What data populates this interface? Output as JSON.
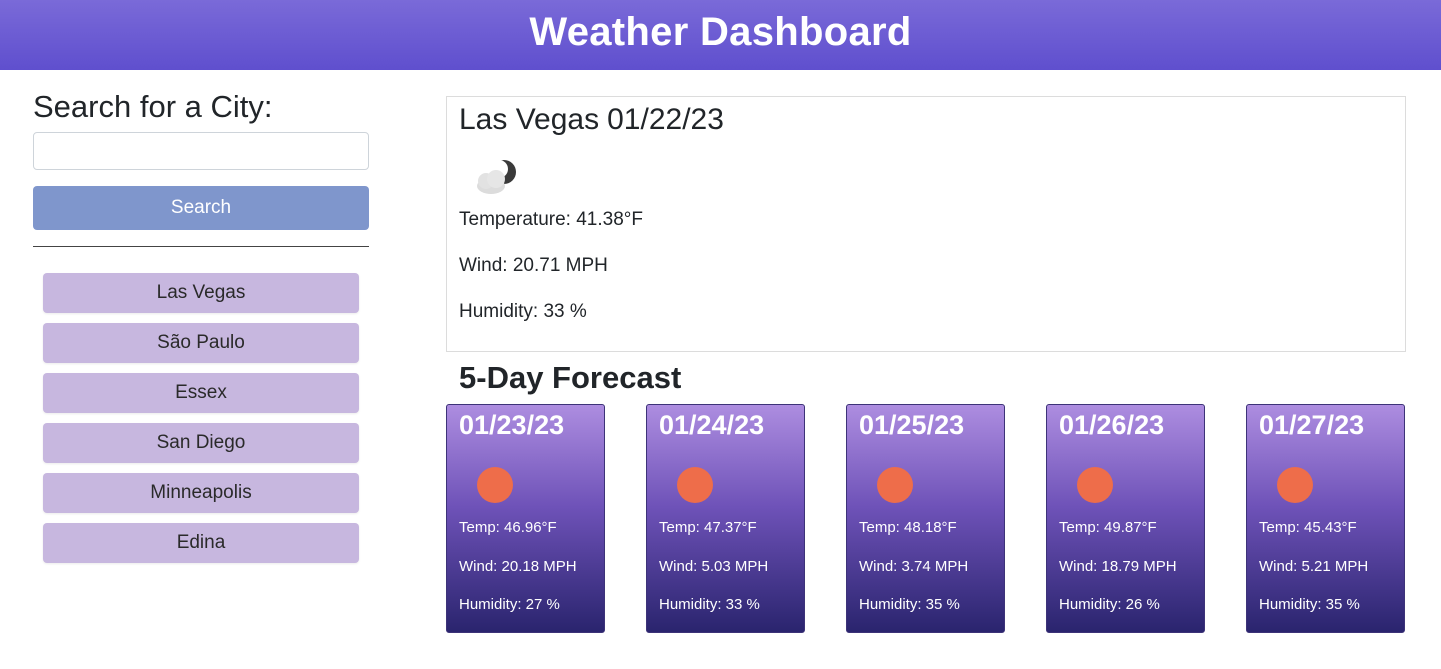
{
  "header": {
    "title": "Weather Dashboard"
  },
  "sidebar": {
    "search_title": "Search for a City:",
    "search_input_value": "",
    "search_button_label": "Search",
    "history": [
      {
        "label": "Las Vegas"
      },
      {
        "label": "São Paulo"
      },
      {
        "label": "Essex"
      },
      {
        "label": "San Diego"
      },
      {
        "label": "Minneapolis"
      },
      {
        "label": "Edina"
      }
    ]
  },
  "current": {
    "city": "Las Vegas",
    "date": "01/22/23",
    "icon": "partly-cloudy-night-icon",
    "temperature": "Temperature: 41.38°F",
    "wind": "Wind: 20.71 MPH",
    "humidity": "Humidity: 33 %"
  },
  "forecast": {
    "title": "5-Day Forecast",
    "days": [
      {
        "date": "01/23/23",
        "icon": "sun-icon",
        "temp": "Temp: 46.96°F",
        "wind": "Wind: 20.18 MPH",
        "humidity": "Humidity: 27 %"
      },
      {
        "date": "01/24/23",
        "icon": "sun-icon",
        "temp": "Temp: 47.37°F",
        "wind": "Wind: 5.03 MPH",
        "humidity": "Humidity: 33 %"
      },
      {
        "date": "01/25/23",
        "icon": "sun-icon",
        "temp": "Temp: 48.18°F",
        "wind": "Wind: 3.74 MPH",
        "humidity": "Humidity: 35 %"
      },
      {
        "date": "01/26/23",
        "icon": "sun-icon",
        "temp": "Temp: 49.87°F",
        "wind": "Wind: 18.79 MPH",
        "humidity": "Humidity: 26 %"
      },
      {
        "date": "01/27/23",
        "icon": "sun-icon",
        "temp": "Temp: 45.43°F",
        "wind": "Wind: 5.21 MPH",
        "humidity": "Humidity: 35 %"
      }
    ]
  },
  "colors": {
    "header": "#6a5ad5",
    "search_button": "#7f96cc",
    "history_button": "#c7b7df",
    "sun": "#ee6d4a"
  }
}
